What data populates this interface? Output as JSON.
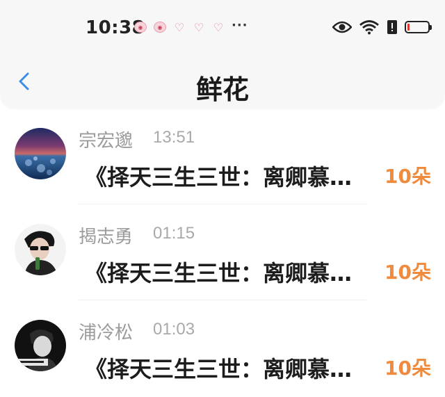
{
  "status_bar": {
    "time": "10:38",
    "notification_icons": [
      "notif-badge-icon",
      "notif-badge-icon",
      "heart-icon",
      "heart-icon",
      "heart-icon"
    ],
    "more": "···",
    "battery_level": 0.05,
    "battery_color": "#e0332c"
  },
  "nav": {
    "title": "鲜花",
    "accent": "#3a8ee6"
  },
  "items": [
    {
      "name": "宗宏邈",
      "time": "13:51",
      "message": "《择天三生三世：离卿慕… ",
      "count": "10朵",
      "avatar": "avatar-lake-ice"
    },
    {
      "name": "揭志勇",
      "time": "01:15",
      "message": "《择天三生三世：离卿慕… ",
      "count": "10朵",
      "avatar": "avatar-man-sunglasses"
    },
    {
      "name": "浦冷松",
      "time": "01:03",
      "message": "《择天三生三世：离卿慕… ",
      "count": "10朵",
      "avatar": "avatar-man-bw"
    }
  ]
}
